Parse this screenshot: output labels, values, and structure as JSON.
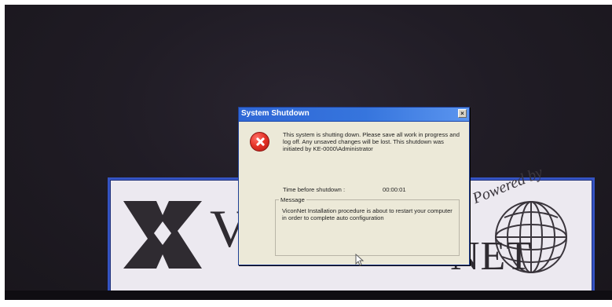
{
  "dialog": {
    "title": "System Shutdown",
    "close_label": "×",
    "message": "This system is shutting down. Please save all work in progress and log off. Any unsaved changes will be lost. This shutdown was initiated by KE-0000\\Administrator",
    "time_label": "Time before shutdown :",
    "time_value": "00:00:01",
    "group_title": "Message",
    "group_message": "ViconNet Installation procedure is about to restart your computer in order to complete auto configuration"
  },
  "banner": {
    "brand_v": "V",
    "powered_by": "Powered by",
    "brand_net": "NET"
  },
  "icons": {
    "error": "error-icon",
    "close": "close-icon",
    "cursor": "mouse-cursor-icon",
    "logo": "logo-icon"
  },
  "colors": {
    "title_bar": "#3675dd",
    "banner_border": "#3554c3",
    "desktop_bg": "#201c25",
    "error_red": "#e43327"
  }
}
